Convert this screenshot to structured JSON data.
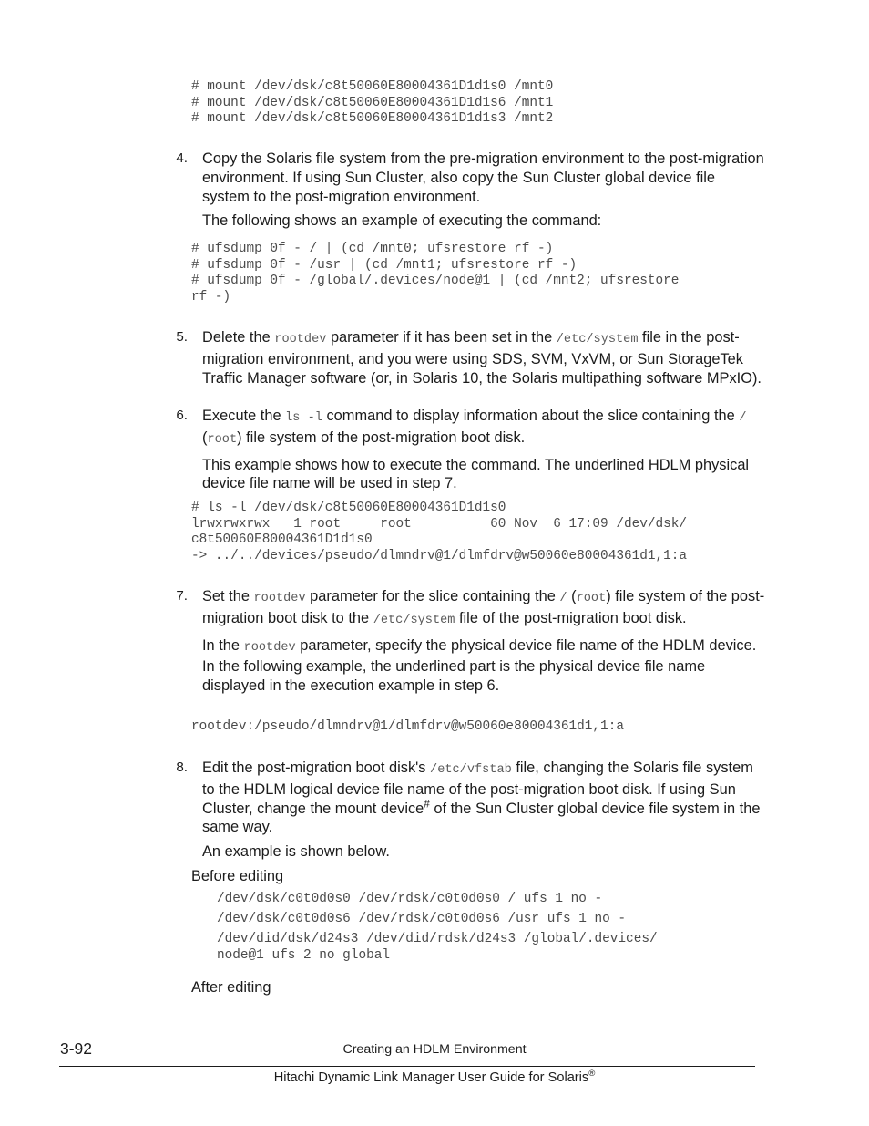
{
  "page": {
    "folio": "3-92",
    "running_head": "Creating an HDLM Environment",
    "guide_title_main": "Hitachi Dynamic Link Manager User Guide for Solaris",
    "guide_title_sup": "®"
  },
  "blocks": {
    "mount_commands": "# mount /dev/dsk/c8t50060E80004361D1d1s0 /mnt0\n# mount /dev/dsk/c8t50060E80004361D1d1s6 /mnt1\n# mount /dev/dsk/c8t50060E80004361D1d1s3 /mnt2",
    "ufsdump_commands": "# ufsdump 0f - / | (cd /mnt0; ufsrestore rf -)\n# ufsdump 0f - /usr | (cd /mnt1; ufsrestore rf -)\n# ufsdump 0f - /global/.devices/node@1 | (cd /mnt2; ufsrestore\nrf -)",
    "ls_output": "# ls -l /dev/dsk/c8t50060E80004361D1d1s0\nlrwxrwxrwx   1 root     root          60 Nov  6 17:09 /dev/dsk/\nc8t50060E80004361D1d1s0\n-> ../../devices/pseudo/dlmndrv@1/dlmfdrv@w50060e80004361d1,1:a",
    "rootdev_line": "rootdev:/pseudo/dlmndrv@1/dlmfdrv@w50060e80004361d1,1:a",
    "vfstab_before": "/dev/dsk/c0t0d0s0 /dev/rdsk/c0t0d0s0 / ufs 1 no -",
    "vfstab_before2": "/dev/dsk/c0t0d0s6 /dev/rdsk/c0t0d0s6 /usr ufs 1 no -",
    "vfstab_before3": "/dev/did/dsk/d24s3 /dev/did/rdsk/d24s3 /global/.devices/\nnode@1 ufs 2 no global"
  },
  "steps": [
    {
      "number": "4.",
      "paragraphs": [
        "Copy the Solaris file system from the pre-migration environment to the post-migration environment. If using Sun Cluster, also copy the Sun Cluster global device file system to the post-migration environment.",
        "The following shows an example of executing the command:"
      ]
    },
    {
      "number": "5.",
      "p5_a": "Delete the ",
      "p5_code1": "rootdev",
      "p5_b": " parameter if it has been set in the ",
      "p5_code2": "/etc/system",
      "p5_c": " file in the post-migration environment, and you were using SDS, SVM, VxVM, or Sun StorageTek Traffic Manager software (or, in Solaris 10, the Solaris multipathing software MPxIO)."
    },
    {
      "number": "6.",
      "p6_a": "Execute the ",
      "p6_code1": "ls -l",
      "p6_b": " command to display information about the slice containing the ",
      "p6_code2": "/",
      "p6_c": " (",
      "p6_code3": "root",
      "p6_d": ") file system of the post-migration boot disk.",
      "p6_second": "This example shows how to execute the command. The underlined HDLM physical device file name will be used in step 7."
    },
    {
      "number": "7.",
      "p7_a": "Set the ",
      "p7_code1": "rootdev",
      "p7_b": " parameter for the slice containing the ",
      "p7_code2": "/",
      "p7_c": " (",
      "p7_code3": "root",
      "p7_d": ") file system of the post-migration boot disk to the ",
      "p7_code4": "/etc/system",
      "p7_e": " file of the post-migration boot disk.",
      "p7_second_a": "In the ",
      "p7_second_code": "rootdev",
      "p7_second_b": " parameter, specify the physical device file name of the HDLM device. In the following example, the underlined part is the physical device file name displayed in the execution example in step 6."
    },
    {
      "number": "8.",
      "p8_a": "Edit the post-migration boot disk's ",
      "p8_code1": "/etc/vfstab",
      "p8_b": " file, changing the Solaris file system to the HDLM logical device file name of the post-migration boot disk. If using Sun Cluster, change the mount device",
      "p8_sup": "#",
      "p8_c": " of the Sun Cluster global device file system in the same way.",
      "p8_second": "An example is shown below.",
      "label_before": "Before editing",
      "label_after": "After editing"
    }
  ]
}
